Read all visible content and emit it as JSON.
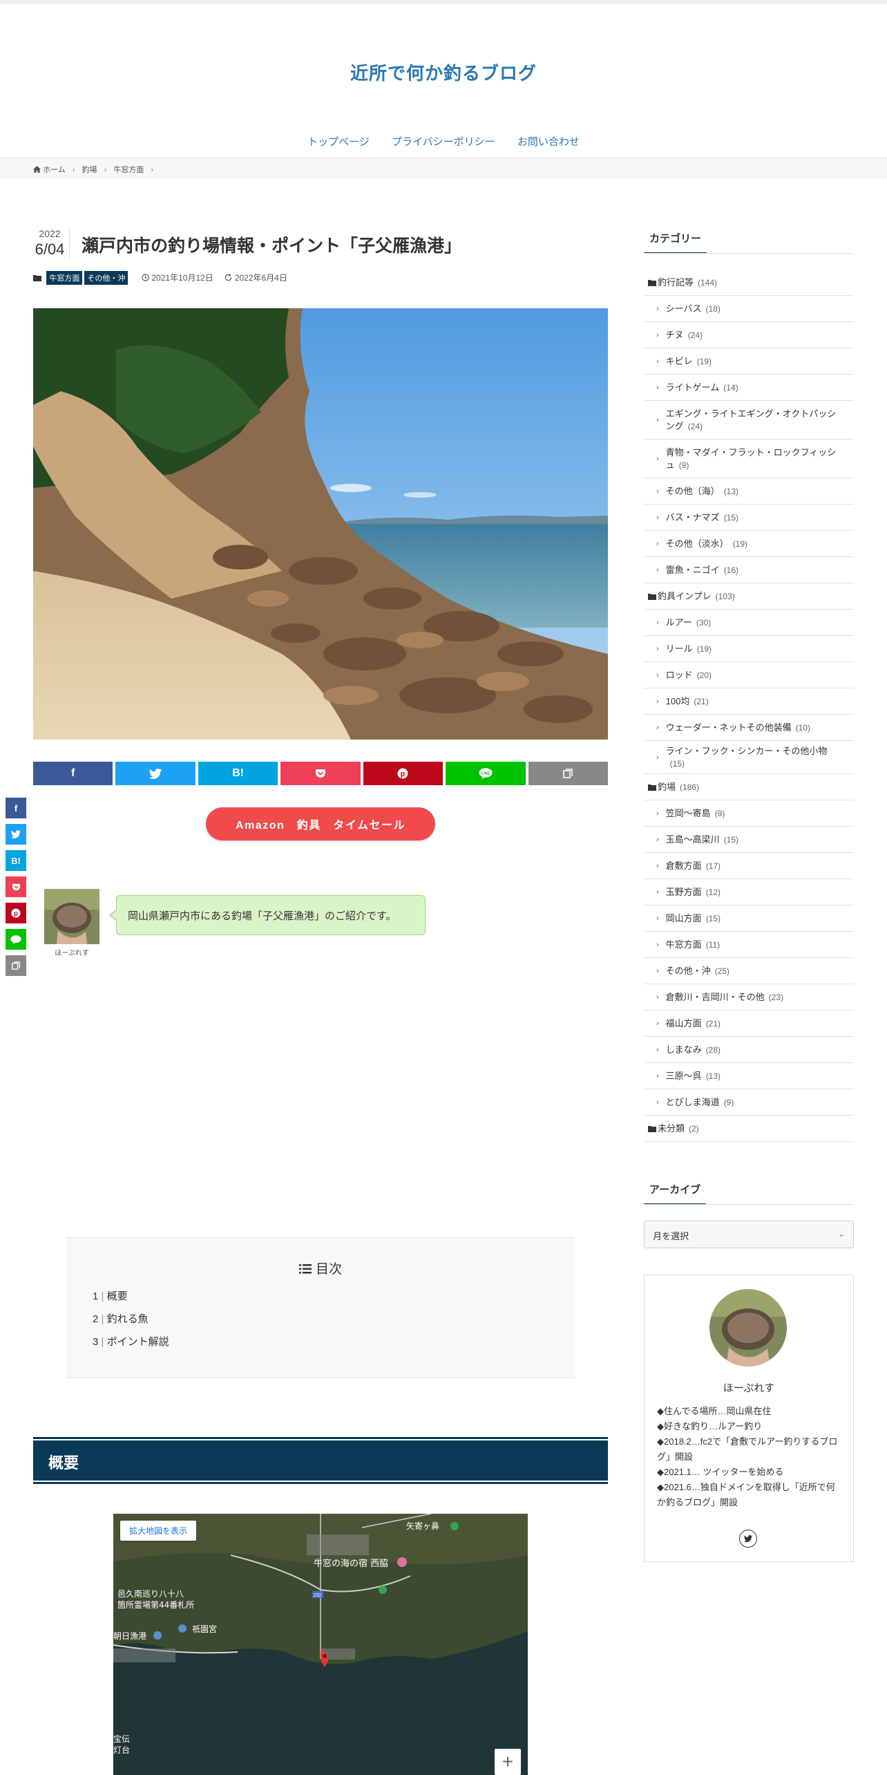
{
  "site": {
    "title": "近所で何か釣るブログ"
  },
  "nav": {
    "items": [
      "トップページ",
      "プライバシーポリシー",
      "お問い合わせ"
    ]
  },
  "breadcrumb": {
    "items": [
      "ホーム",
      "釣場",
      "牛窓方面"
    ]
  },
  "post": {
    "year": "2022",
    "month_day": "6/04",
    "title": "瀬戸内市の釣り場情報・ポイント「子父雁漁港」",
    "categories": [
      "牛窓方面",
      "その他・沖"
    ],
    "published": "2021年10月12日",
    "updated": "2022年6月4日"
  },
  "share": {
    "buttons": [
      {
        "name": "facebook",
        "label": "f",
        "color": "#3b5998"
      },
      {
        "name": "twitter",
        "label": "t",
        "color": "#1da1f2"
      },
      {
        "name": "hatena",
        "label": "B!",
        "color": "#00a4de"
      },
      {
        "name": "pocket",
        "label": "P",
        "color": "#ef3f56"
      },
      {
        "name": "pinterest",
        "label": "P",
        "color": "#bd081c"
      },
      {
        "name": "line",
        "label": "LINE",
        "color": "#00c300"
      },
      {
        "name": "copy",
        "label": "C",
        "color": "#888888"
      }
    ]
  },
  "amazon_button": "Amazon　釣具　タイムセール",
  "author": {
    "name": "ほーぷれす"
  },
  "balloon": {
    "text": "岡山県瀬戸内市にある釣場「子父雁漁港」のご紹介です。"
  },
  "toc": {
    "title": "目次",
    "items": [
      {
        "num": "1",
        "label": "概要"
      },
      {
        "num": "2",
        "label": "釣れる魚"
      },
      {
        "num": "3",
        "label": "ポイント解説"
      }
    ]
  },
  "section": {
    "heading": "概要"
  },
  "map": {
    "enlarge_label": "拡大地図を表示",
    "zoom_label": "+",
    "labels": [
      "牛窓の海の宿 西脇",
      "邑久南巡り八十八",
      "箇所霊場第44番札所",
      "祇園宮",
      "朝日漁港",
      "宝伝",
      "灯台",
      "矢寄ヶ鼻",
      "232"
    ]
  },
  "sidebar": {
    "category_title": "カテゴリー",
    "categories": [
      {
        "label": "釣行記等",
        "count": "(144)",
        "level": 0
      },
      {
        "label": "シーバス",
        "count": "(18)",
        "level": 1
      },
      {
        "label": "チヌ",
        "count": "(24)",
        "level": 1
      },
      {
        "label": "キビレ",
        "count": "(19)",
        "level": 1
      },
      {
        "label": "ライトゲーム",
        "count": "(14)",
        "level": 1
      },
      {
        "label": "エギング・ライトエギング・オクトパッシング",
        "count": "(24)",
        "level": 1
      },
      {
        "label": "青物・マダイ・フラット・ロックフィッシュ",
        "count": "(9)",
        "level": 1
      },
      {
        "label": "その他（海）",
        "count": "(13)",
        "level": 1
      },
      {
        "label": "バス・ナマズ",
        "count": "(15)",
        "level": 1
      },
      {
        "label": "その他（淡水）",
        "count": "(19)",
        "level": 1
      },
      {
        "label": "雷魚・ニゴイ",
        "count": "(16)",
        "level": 1
      },
      {
        "label": "釣具インプレ",
        "count": "(103)",
        "level": 0
      },
      {
        "label": "ルアー",
        "count": "(30)",
        "level": 1
      },
      {
        "label": "リール",
        "count": "(19)",
        "level": 1
      },
      {
        "label": "ロッド",
        "count": "(20)",
        "level": 1
      },
      {
        "label": "100均",
        "count": "(21)",
        "level": 1
      },
      {
        "label": "ウェーダー・ネットその他装備",
        "count": "(10)",
        "level": 1
      },
      {
        "label": "ライン・フック・シンカー・その他小物",
        "count": "(15)",
        "level": 1
      },
      {
        "label": "釣場",
        "count": "(186)",
        "level": 0
      },
      {
        "label": "笠岡～寄島",
        "count": "(9)",
        "level": 1
      },
      {
        "label": "玉島～高梁川",
        "count": "(15)",
        "level": 1
      },
      {
        "label": "倉敷方面",
        "count": "(17)",
        "level": 1
      },
      {
        "label": "玉野方面",
        "count": "(12)",
        "level": 1
      },
      {
        "label": "岡山方面",
        "count": "(15)",
        "level": 1
      },
      {
        "label": "牛窓方面",
        "count": "(11)",
        "level": 1
      },
      {
        "label": "その他・沖",
        "count": "(25)",
        "level": 1
      },
      {
        "label": "倉敷川・吉岡川・その他",
        "count": "(23)",
        "level": 1
      },
      {
        "label": "福山方面",
        "count": "(21)",
        "level": 1
      },
      {
        "label": "しまなみ",
        "count": "(28)",
        "level": 1
      },
      {
        "label": "三原～呉",
        "count": "(13)",
        "level": 1
      },
      {
        "label": "とびしま海道",
        "count": "(9)",
        "level": 1
      },
      {
        "label": "未分類",
        "count": "(2)",
        "level": 0
      }
    ],
    "archive_title": "アーカイブ",
    "archive_select": "月を選択",
    "profile": {
      "name": "ほーぷれす",
      "lines": [
        "◆住んでる場所…岡山県在住",
        "◆好きな釣り…ルアー釣り",
        "◆2018.2…fc2で「倉敷でルアー釣りするブログ」開設",
        "◆2021.1… ツイッターを始める",
        "◆2021.6…独自ドメインを取得し「近所で何か釣るブログ」開設"
      ]
    }
  }
}
